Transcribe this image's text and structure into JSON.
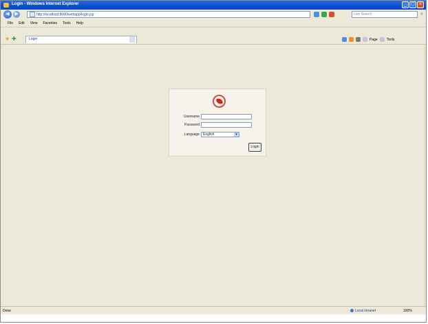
{
  "window": {
    "title": "Login - Windows Internet Explorer"
  },
  "address_bar": {
    "url": "http://localhost:8080/webapp/login.jsp",
    "search_placeholder": "Live Search"
  },
  "menu": [
    "File",
    "Edit",
    "View",
    "Favorites",
    "Tools",
    "Help"
  ],
  "tab": {
    "label": "Login"
  },
  "command_bar": {
    "page_label": "Page",
    "tools_label": "Tools"
  },
  "login_form": {
    "username_label": "Username",
    "password_label": "Password",
    "language_label": "Language",
    "language_value": "English",
    "submit_label": "Login"
  },
  "status_bar": {
    "status": "Done",
    "zone": "Local intranet",
    "zoom": "100%"
  }
}
